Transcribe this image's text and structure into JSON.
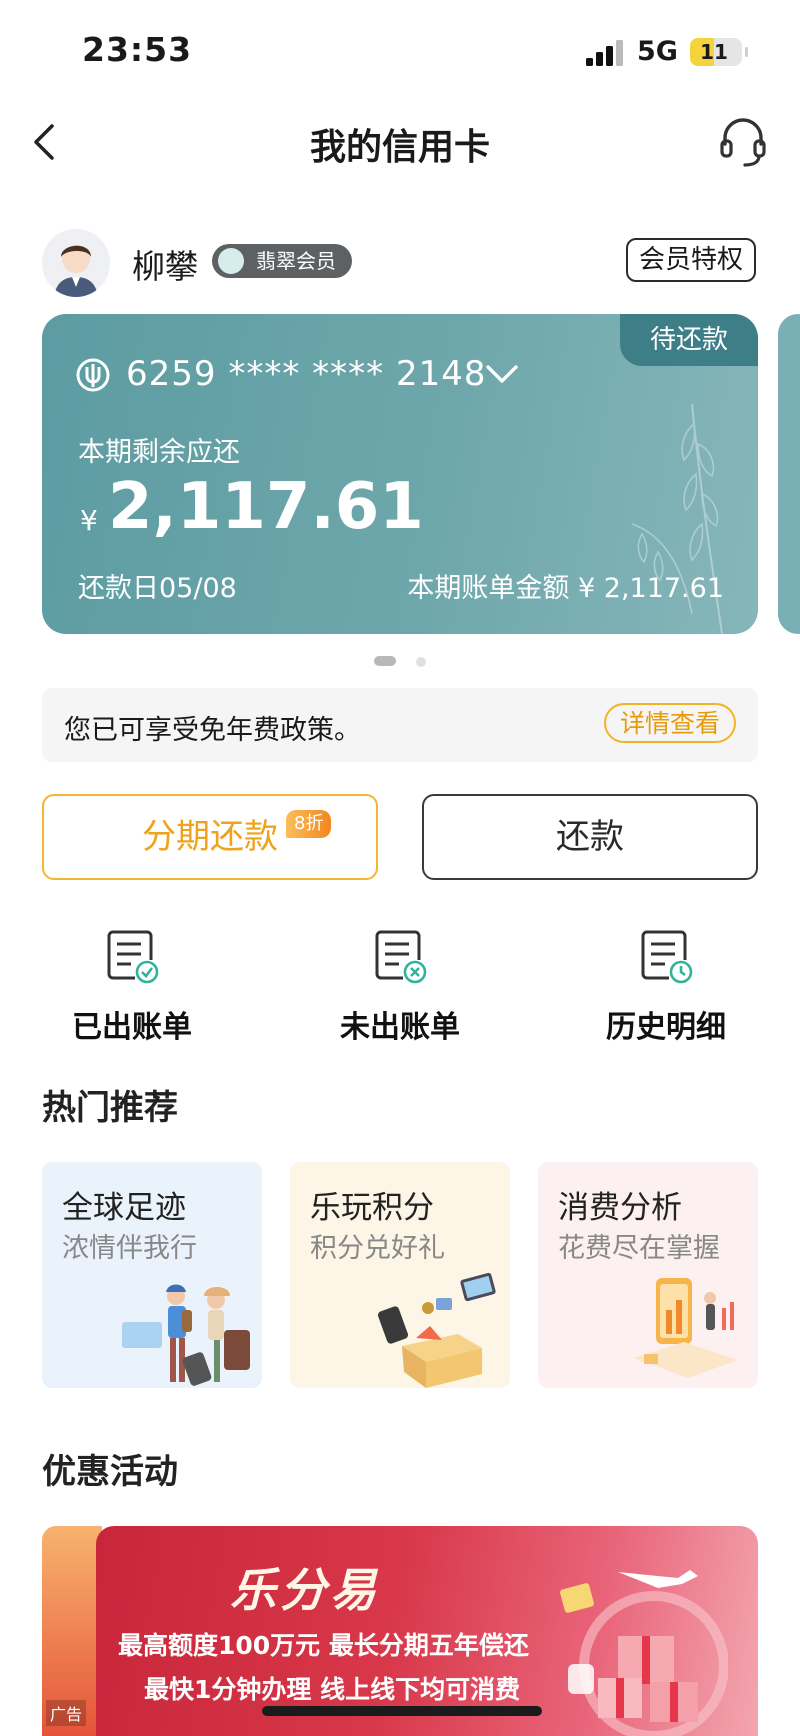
{
  "status_bar": {
    "time": "23:53",
    "network": "5G",
    "battery": "11"
  },
  "nav": {
    "title": "我的信用卡"
  },
  "user": {
    "name": "柳攀",
    "member_level": "翡翠会员",
    "privilege_button": "会员特权"
  },
  "card": {
    "status_tag": "待还款",
    "number": "6259 **** **** 2148",
    "remaining_label": "本期剩余应还",
    "currency_symbol": "¥",
    "remaining_amount": "2,117.61",
    "due_date": "还款日05/08",
    "bill_amount": "本期账单金额 ¥ 2,117.61"
  },
  "notice": {
    "text": "您已可享受免年费政策。",
    "button": "详情查看"
  },
  "actions": {
    "installment": "分期还款",
    "installment_badge": "8折",
    "repay": "还款"
  },
  "bills": [
    {
      "label": "已出账单",
      "icon": "bill-check-icon"
    },
    {
      "label": "未出账单",
      "icon": "bill-x-icon"
    },
    {
      "label": "历史明细",
      "icon": "bill-clock-icon"
    }
  ],
  "hot": {
    "title": "热门推荐",
    "items": [
      {
        "title": "全球足迹",
        "subtitle": "浓情伴我行"
      },
      {
        "title": "乐玩积分",
        "subtitle": "积分兑好礼"
      },
      {
        "title": "消费分析",
        "subtitle": "花费尽在掌握"
      }
    ]
  },
  "promo": {
    "title": "优惠活动",
    "brand": "乐分易",
    "line1": "最高额度100万元 最长分期五年偿还",
    "line2": "最快1分钟办理 线上线下均可消费",
    "ad_tag": "广告"
  },
  "colors": {
    "card": "#6ea7ab",
    "accent": "#f3b630",
    "promo": "#d8384a"
  }
}
